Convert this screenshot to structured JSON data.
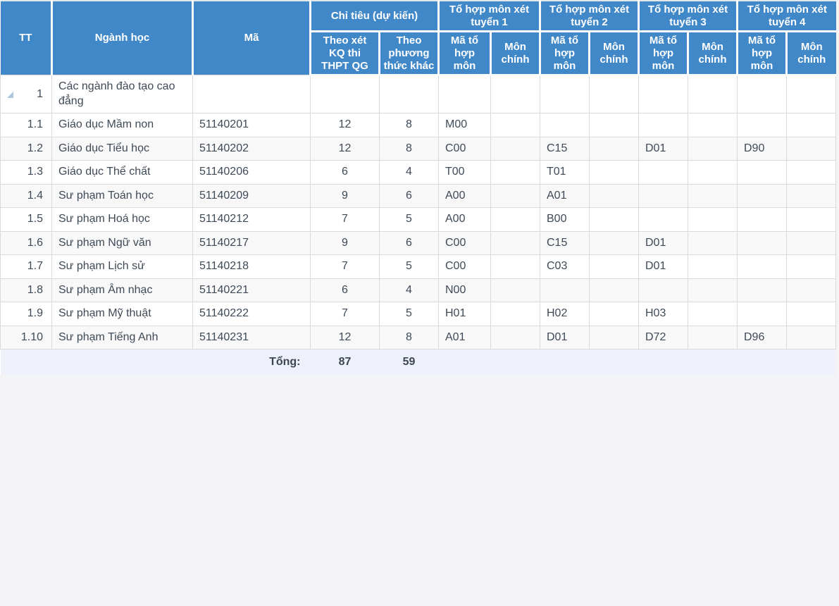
{
  "table": {
    "header": {
      "tt": "TT",
      "nganh_hoc": "Ngành học",
      "ma": "Mã",
      "chi_tieu_group": "Chỉ tiêu (dự kiến)",
      "chi_tieu_thpt": "Theo xét KQ thi THPT QG",
      "chi_tieu_khac": "Theo phương thức khác",
      "to_hop_1": "Tổ hợp môn xét tuyển 1",
      "to_hop_2": "Tổ hợp môn xét tuyển 2",
      "to_hop_3": "Tổ hợp môn xét tuyển 3",
      "to_hop_4": "Tổ hợp môn xét tuyển 4",
      "ma_to_hop_mon": "Mã tổ hợp môn",
      "mon_chinh": "Môn chính"
    },
    "rows": [
      {
        "tt": "1",
        "nganh_hoc": "Các ngành đào tạo cao đẳng",
        "ma": "",
        "ct_thpt": "",
        "ct_khac": "",
        "ma_th_1": "",
        "mc_1": "",
        "ma_th_2": "",
        "mc_2": "",
        "ma_th_3": "",
        "mc_3": "",
        "ma_th_4": "",
        "mc_4": "",
        "is_group": true
      },
      {
        "tt": "1.1",
        "nganh_hoc": "Giáo dục Mầm non",
        "ma": "51140201",
        "ct_thpt": "12",
        "ct_khac": "8",
        "ma_th_1": "M00",
        "mc_1": "",
        "ma_th_2": "",
        "mc_2": "",
        "ma_th_3": "",
        "mc_3": "",
        "ma_th_4": "",
        "mc_4": "",
        "is_group": false
      },
      {
        "tt": "1.2",
        "nganh_hoc": "Giáo dục Tiểu học",
        "ma": "51140202",
        "ct_thpt": "12",
        "ct_khac": "8",
        "ma_th_1": "C00",
        "mc_1": "",
        "ma_th_2": "C15",
        "mc_2": "",
        "ma_th_3": "D01",
        "mc_3": "",
        "ma_th_4": "D90",
        "mc_4": "",
        "is_group": false
      },
      {
        "tt": "1.3",
        "nganh_hoc": "Giáo dục Thể chất",
        "ma": "51140206",
        "ct_thpt": "6",
        "ct_khac": "4",
        "ma_th_1": "T00",
        "mc_1": "",
        "ma_th_2": "T01",
        "mc_2": "",
        "ma_th_3": "",
        "mc_3": "",
        "ma_th_4": "",
        "mc_4": "",
        "is_group": false
      },
      {
        "tt": "1.4",
        "nganh_hoc": "Sư phạm Toán học",
        "ma": "51140209",
        "ct_thpt": "9",
        "ct_khac": "6",
        "ma_th_1": "A00",
        "mc_1": "",
        "ma_th_2": "A01",
        "mc_2": "",
        "ma_th_3": "",
        "mc_3": "",
        "ma_th_4": "",
        "mc_4": "",
        "is_group": false
      },
      {
        "tt": "1.5",
        "nganh_hoc": "Sư phạm Hoá học",
        "ma": "51140212",
        "ct_thpt": "7",
        "ct_khac": "5",
        "ma_th_1": "A00",
        "mc_1": "",
        "ma_th_2": "B00",
        "mc_2": "",
        "ma_th_3": "",
        "mc_3": "",
        "ma_th_4": "",
        "mc_4": "",
        "is_group": false
      },
      {
        "tt": "1.6",
        "nganh_hoc": "Sư phạm Ngữ văn",
        "ma": "51140217",
        "ct_thpt": "9",
        "ct_khac": "6",
        "ma_th_1": "C00",
        "mc_1": "",
        "ma_th_2": "C15",
        "mc_2": "",
        "ma_th_3": "D01",
        "mc_3": "",
        "ma_th_4": "",
        "mc_4": "",
        "is_group": false
      },
      {
        "tt": "1.7",
        "nganh_hoc": "Sư phạm Lịch sử",
        "ma": "51140218",
        "ct_thpt": "7",
        "ct_khac": "5",
        "ma_th_1": "C00",
        "mc_1": "",
        "ma_th_2": "C03",
        "mc_2": "",
        "ma_th_3": "D01",
        "mc_3": "",
        "ma_th_4": "",
        "mc_4": "",
        "is_group": false
      },
      {
        "tt": "1.8",
        "nganh_hoc": "Sư phạm Âm nhạc",
        "ma": "51140221",
        "ct_thpt": "6",
        "ct_khac": "4",
        "ma_th_1": "N00",
        "mc_1": "",
        "ma_th_2": "",
        "mc_2": "",
        "ma_th_3": "",
        "mc_3": "",
        "ma_th_4": "",
        "mc_4": "",
        "is_group": false
      },
      {
        "tt": "1.9",
        "nganh_hoc": "Sư phạm Mỹ thuật",
        "ma": "51140222",
        "ct_thpt": "7",
        "ct_khac": "5",
        "ma_th_1": "H01",
        "mc_1": "",
        "ma_th_2": "H02",
        "mc_2": "",
        "ma_th_3": "H03",
        "mc_3": "",
        "ma_th_4": "",
        "mc_4": "",
        "is_group": false
      },
      {
        "tt": "1.10",
        "nganh_hoc": "Sư phạm Tiếng Anh",
        "ma": "51140231",
        "ct_thpt": "12",
        "ct_khac": "8",
        "ma_th_1": "A01",
        "mc_1": "",
        "ma_th_2": "D01",
        "mc_2": "",
        "ma_th_3": "D72",
        "mc_3": "",
        "ma_th_4": "D96",
        "mc_4": "",
        "is_group": false
      }
    ],
    "footer": {
      "label": "Tổng:",
      "total_thpt": "87",
      "total_khac": "59"
    },
    "colors": {
      "header_bg": "#4188c9",
      "header_text": "#ffffff",
      "row_alt_bg": "#f8f8f9",
      "footer_bg": "#eef1fa",
      "grid_line": "#ddd8da",
      "collapse_icon": "#a8c6e2"
    }
  }
}
